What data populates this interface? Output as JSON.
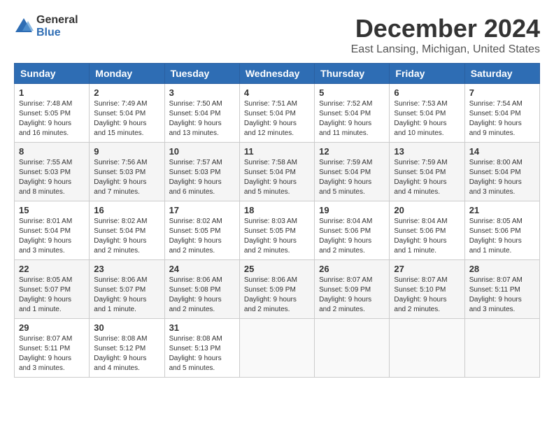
{
  "logo": {
    "general": "General",
    "blue": "Blue"
  },
  "title": "December 2024",
  "location": "East Lansing, Michigan, United States",
  "weekdays": [
    "Sunday",
    "Monday",
    "Tuesday",
    "Wednesday",
    "Thursday",
    "Friday",
    "Saturday"
  ],
  "weeks": [
    [
      {
        "day": "1",
        "sunrise": "7:48 AM",
        "sunset": "5:05 PM",
        "daylight": "9 hours and 16 minutes."
      },
      {
        "day": "2",
        "sunrise": "7:49 AM",
        "sunset": "5:04 PM",
        "daylight": "9 hours and 15 minutes."
      },
      {
        "day": "3",
        "sunrise": "7:50 AM",
        "sunset": "5:04 PM",
        "daylight": "9 hours and 13 minutes."
      },
      {
        "day": "4",
        "sunrise": "7:51 AM",
        "sunset": "5:04 PM",
        "daylight": "9 hours and 12 minutes."
      },
      {
        "day": "5",
        "sunrise": "7:52 AM",
        "sunset": "5:04 PM",
        "daylight": "9 hours and 11 minutes."
      },
      {
        "day": "6",
        "sunrise": "7:53 AM",
        "sunset": "5:04 PM",
        "daylight": "9 hours and 10 minutes."
      },
      {
        "day": "7",
        "sunrise": "7:54 AM",
        "sunset": "5:04 PM",
        "daylight": "9 hours and 9 minutes."
      }
    ],
    [
      {
        "day": "8",
        "sunrise": "7:55 AM",
        "sunset": "5:03 PM",
        "daylight": "9 hours and 8 minutes."
      },
      {
        "day": "9",
        "sunrise": "7:56 AM",
        "sunset": "5:03 PM",
        "daylight": "9 hours and 7 minutes."
      },
      {
        "day": "10",
        "sunrise": "7:57 AM",
        "sunset": "5:03 PM",
        "daylight": "9 hours and 6 minutes."
      },
      {
        "day": "11",
        "sunrise": "7:58 AM",
        "sunset": "5:04 PM",
        "daylight": "9 hours and 5 minutes."
      },
      {
        "day": "12",
        "sunrise": "7:59 AM",
        "sunset": "5:04 PM",
        "daylight": "9 hours and 5 minutes."
      },
      {
        "day": "13",
        "sunrise": "7:59 AM",
        "sunset": "5:04 PM",
        "daylight": "9 hours and 4 minutes."
      },
      {
        "day": "14",
        "sunrise": "8:00 AM",
        "sunset": "5:04 PM",
        "daylight": "9 hours and 3 minutes."
      }
    ],
    [
      {
        "day": "15",
        "sunrise": "8:01 AM",
        "sunset": "5:04 PM",
        "daylight": "9 hours and 3 minutes."
      },
      {
        "day": "16",
        "sunrise": "8:02 AM",
        "sunset": "5:04 PM",
        "daylight": "9 hours and 2 minutes."
      },
      {
        "day": "17",
        "sunrise": "8:02 AM",
        "sunset": "5:05 PM",
        "daylight": "9 hours and 2 minutes."
      },
      {
        "day": "18",
        "sunrise": "8:03 AM",
        "sunset": "5:05 PM",
        "daylight": "9 hours and 2 minutes."
      },
      {
        "day": "19",
        "sunrise": "8:04 AM",
        "sunset": "5:06 PM",
        "daylight": "9 hours and 2 minutes."
      },
      {
        "day": "20",
        "sunrise": "8:04 AM",
        "sunset": "5:06 PM",
        "daylight": "9 hours and 1 minute."
      },
      {
        "day": "21",
        "sunrise": "8:05 AM",
        "sunset": "5:06 PM",
        "daylight": "9 hours and 1 minute."
      }
    ],
    [
      {
        "day": "22",
        "sunrise": "8:05 AM",
        "sunset": "5:07 PM",
        "daylight": "9 hours and 1 minute."
      },
      {
        "day": "23",
        "sunrise": "8:06 AM",
        "sunset": "5:07 PM",
        "daylight": "9 hours and 1 minute."
      },
      {
        "day": "24",
        "sunrise": "8:06 AM",
        "sunset": "5:08 PM",
        "daylight": "9 hours and 2 minutes."
      },
      {
        "day": "25",
        "sunrise": "8:06 AM",
        "sunset": "5:09 PM",
        "daylight": "9 hours and 2 minutes."
      },
      {
        "day": "26",
        "sunrise": "8:07 AM",
        "sunset": "5:09 PM",
        "daylight": "9 hours and 2 minutes."
      },
      {
        "day": "27",
        "sunrise": "8:07 AM",
        "sunset": "5:10 PM",
        "daylight": "9 hours and 2 minutes."
      },
      {
        "day": "28",
        "sunrise": "8:07 AM",
        "sunset": "5:11 PM",
        "daylight": "9 hours and 3 minutes."
      }
    ],
    [
      {
        "day": "29",
        "sunrise": "8:07 AM",
        "sunset": "5:11 PM",
        "daylight": "9 hours and 3 minutes."
      },
      {
        "day": "30",
        "sunrise": "8:08 AM",
        "sunset": "5:12 PM",
        "daylight": "9 hours and 4 minutes."
      },
      {
        "day": "31",
        "sunrise": "8:08 AM",
        "sunset": "5:13 PM",
        "daylight": "9 hours and 5 minutes."
      },
      null,
      null,
      null,
      null
    ]
  ]
}
